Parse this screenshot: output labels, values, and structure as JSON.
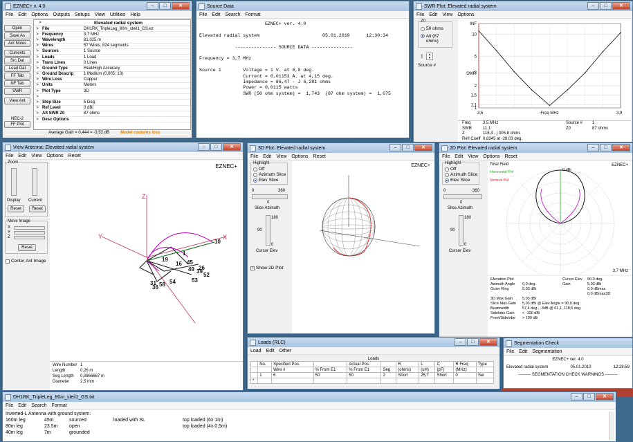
{
  "main_win": {
    "title": "EZNEC+  v. 4.0",
    "menu": [
      "File",
      "Edit",
      "Options",
      "Outputs",
      "Setups",
      "View",
      "Utilities",
      "Help"
    ],
    "header": "Elevated radial system",
    "buttons": [
      "Open",
      "Save As",
      "Ant Notes",
      "Currents",
      "Src Dat",
      "Load Dat",
      "FF Tab",
      "NF Tab",
      "SWR",
      "View Ant"
    ],
    "nec_label": "NEC-2",
    "ff_plot": "FF Plot",
    "rows": [
      {
        "k": "File",
        "v": "DH1RK_TripleLeg_80m_steil1_GS.ez"
      },
      {
        "k": "Frequency",
        "v": "3,7 MHz"
      },
      {
        "k": "Wavelength",
        "v": "81,025 m"
      },
      {
        "k": "Wires",
        "v": "57 Wires, 824 segments"
      },
      {
        "k": "Sources",
        "v": "1 Source"
      },
      {
        "k": "Loads",
        "v": "1 Load"
      },
      {
        "k": "Trans Lines",
        "v": "0 Lines"
      },
      {
        "k": "Ground Type",
        "v": "Real/High Accuracy"
      },
      {
        "k": "Ground Descrip",
        "v": "1 Medium (0,005; 13)"
      },
      {
        "k": "Wire Loss",
        "v": "Copper"
      },
      {
        "k": "Units",
        "v": "Meters"
      },
      {
        "k": "Plot Type",
        "v": "3D"
      },
      {
        "k": "",
        "v": ""
      },
      {
        "k": "Step Size",
        "v": "5 Deg."
      },
      {
        "k": "Ref Level",
        "v": "0 dBi"
      },
      {
        "k": "Alt SWR Z0",
        "v": "87 ohms"
      },
      {
        "k": "Desc Options",
        "v": ""
      }
    ],
    "avg_gain": "Average Gain = 0,444 = -3,52 dB",
    "warn": "Model contains loss"
  },
  "source_win": {
    "title": "Source Data",
    "menu": [
      "File",
      "Edit",
      "Search",
      "Format"
    ],
    "lines": [
      "                        EZNEC+ ver. 4.0",
      "",
      "Elevated radial system                       05.01.2010      12:30:34",
      "",
      "             --------------- SOURCE DATA ---------------",
      "",
      "Frequency = 3,7 MHz",
      "",
      "Source 1        Voltage = 1 V. at 0,0 deg.",
      "                Current = 0,01153 A. at 4,15 deg.",
      "                Impedance = 86,47 - J 6,281 ohms",
      "                Power = 0,0115 watts",
      "                SWR (50 ohm system) =  1,743  (87 ohm system) =  1,075"
    ]
  },
  "swr_win": {
    "title": "SWR Plot: Elevated radial system",
    "menu": [
      "File",
      "Edit",
      "View",
      "Options"
    ],
    "z0_label": "Z0",
    "z0_opts": [
      "50 ohms",
      "Alt (87 ohms)"
    ],
    "source_label": "Source #",
    "source_val": "1",
    "y_label": "SWR",
    "y_ticks": [
      "INF",
      "10",
      "5",
      "3",
      "2",
      "1,5",
      "1,1",
      "1"
    ],
    "x_ticks": [
      "3,5",
      "Freq MHz",
      "3,9"
    ],
    "info": [
      [
        "Freq",
        "3,5 MHz",
        "Source #",
        "1"
      ],
      [
        "SWR",
        "11,1",
        "Z0",
        "87 ohms"
      ],
      [
        "Z",
        "118,4 - j 305,8 ohms",
        "",
        ""
      ],
      [
        "Refl Coeff",
        "0,8345 at -28,03 deg.",
        "",
        ""
      ]
    ]
  },
  "chart_data": {
    "type": "line",
    "x": [
      3.5,
      3.55,
      3.6,
      3.65,
      3.7,
      3.75,
      3.8,
      3.85,
      3.9
    ],
    "values": [
      11.1,
      6.0,
      3.1,
      1.75,
      1.08,
      1.75,
      3.0,
      5.8,
      10.5
    ],
    "xlabel": "Freq MHz",
    "ylabel": "SWR",
    "xlim": [
      3.5,
      3.9
    ],
    "log_scale_y": true
  },
  "view_win": {
    "title": "View Antenna: Elevated radial system",
    "menu": [
      "File",
      "Edit",
      "View",
      "Options",
      "Reset"
    ],
    "brand": "EZNEC+",
    "zoom": "Zoom",
    "display": "Display",
    "current": "Current",
    "reset": "Reset",
    "move_image": "Move Image",
    "axes": [
      "X",
      "Y",
      "Z"
    ],
    "center": "Center Ant Image",
    "axis_x": "X",
    "axis_y": "Y",
    "axis_z": "Z",
    "wire_labels": [
      "10",
      "19",
      "16",
      "45",
      "1",
      "49",
      "53",
      "52",
      "54",
      "58",
      "26",
      "39",
      "31",
      "36"
    ],
    "info": [
      [
        "Wire Number",
        "1"
      ],
      [
        "Length",
        "0,26 m"
      ],
      [
        "Seg Length",
        "0,0866667 m"
      ],
      [
        "Diameter",
        "2,5 mm"
      ]
    ]
  },
  "plot3d_win": {
    "title": "3D Plot: Elevated radial system",
    "menu": [
      "File",
      "Edit",
      "View",
      "Options",
      "Reset"
    ],
    "brand": "EZNEC+",
    "highlight": "Highlight",
    "opts": [
      "Off",
      "Azimuth Slice",
      "Elev Slice"
    ],
    "scale_min": "0",
    "scale_max": "360",
    "scale_val": "0",
    "slice_az": "Slice Azimuth",
    "cursor_top": "180",
    "cursor_mid": "90",
    "cursor_bot": "0",
    "cursor_elev": "Cursor Elev",
    "show2d": "Show 2D Plot"
  },
  "plot2d_win": {
    "title": "2D Plot: Elevated radial system",
    "menu": [
      "File",
      "Edit",
      "View",
      "Options",
      "Reset"
    ],
    "brand": "EZNEC+",
    "highlight": "Highlight",
    "opts": [
      "Off",
      "Azimuth Slice",
      "Elev Slice"
    ],
    "scale_min": "0",
    "scale_max": "360",
    "scale_val": "0",
    "slice_az": "Slice Azimuth",
    "cursor_top": "180",
    "cursor_mid": "90",
    "cursor_bot": "0",
    "cursor_elev": "Cursor Elev",
    "legend": [
      "Total Field",
      "Horizontal Pol",
      "Vertical Pol"
    ],
    "polar_label": "0 dBi",
    "freq": "3,7 MHz",
    "info_left": [
      [
        "Elevation Plot",
        ""
      ],
      [
        "Azimuth Angle",
        "0,0 deg."
      ],
      [
        "Outer Ring",
        "5,03 dBi"
      ],
      [
        "",
        ""
      ],
      [
        "3D Max Gain",
        "5,03 dBi"
      ],
      [
        "Slice Max Gain",
        "5,03 dBi @ Elev Angle = 90,0 deg."
      ],
      [
        "Beamwidth",
        "57,4 deg.; -3dB @ 61,1, 118,5 deg."
      ],
      [
        "Sidelobe Gain",
        "< -100 dBi"
      ],
      [
        "Front/Sidelobe",
        "> 100 dB"
      ]
    ],
    "info_right": [
      [
        "Cursor Elev",
        "90,0 deg."
      ],
      [
        "Gain",
        "5,03 dBi"
      ],
      [
        "",
        "0,0 dBmax"
      ],
      [
        "",
        "0,0 dBmax3D"
      ]
    ]
  },
  "loads_win": {
    "title": "Loads (RLC)",
    "menu": [
      "Load",
      "Edit",
      "Other"
    ],
    "caption": "Loads",
    "headers1": [
      "",
      "No.",
      "Specified Pos.",
      "",
      "Actual Pos.",
      "",
      "R",
      "L",
      "C",
      "R Freq",
      "Type"
    ],
    "headers2": [
      "",
      "",
      "Wire #",
      "% From E1",
      "% From E1",
      "Seg",
      "(ohms)",
      "(uH)",
      "(pF)",
      "(MHz)",
      ""
    ],
    "row": [
      "",
      "1",
      "6",
      "50",
      "50",
      "2",
      "Short",
      "25,7",
      "Short",
      "0",
      "Ser"
    ],
    "newrow": "*"
  },
  "seg_win": {
    "title": "Segmentation Check",
    "menu": [
      "File",
      "Edit",
      "Segmentation"
    ],
    "l1": "EZNEC+ ver. 4.0",
    "l2a": "Elevated radial system",
    "l2b": "05.01.2010",
    "l2c": "12:28:59",
    "l3": "--------- SEGMENTATION CHECK WARNINGS ---------"
  },
  "txt_win": {
    "title": "DH1RK_TripleLeg_80m_steil1_GS.txt",
    "menu": [
      "File",
      "Edit",
      "Search",
      "Format"
    ],
    "lines": [
      [
        "Inverted-L Antenna with ground system:",
        "",
        "",
        "",
        ""
      ],
      [
        "160m leg",
        "45m",
        "sourced",
        "loaded with SL",
        "top loaded (6x 1m)"
      ],
      [
        "80m leg",
        "23.5m",
        "open",
        "",
        "top loaded (4x 0,5m)"
      ],
      [
        "40m leg",
        "7m",
        "grounded",
        "",
        ""
      ]
    ]
  }
}
